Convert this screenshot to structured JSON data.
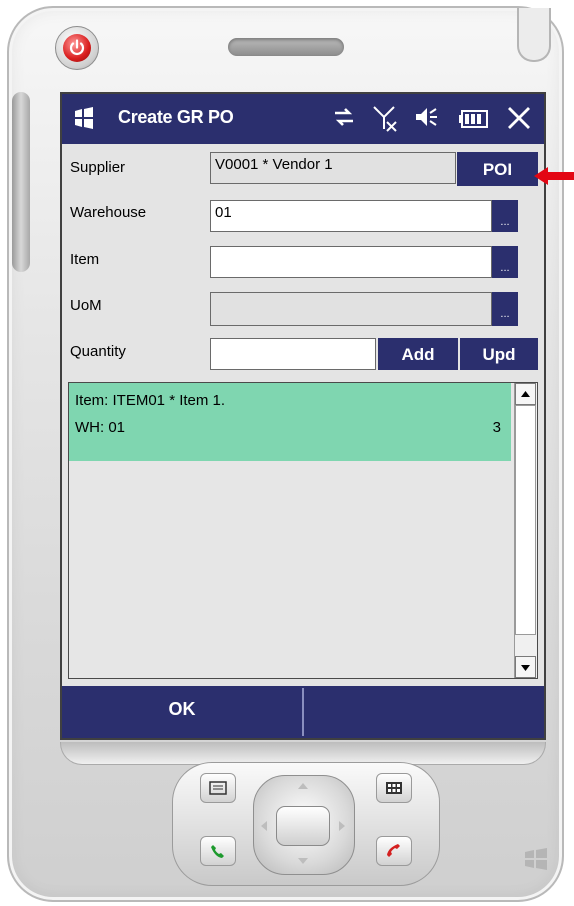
{
  "app": {
    "title": "Create GR PO"
  },
  "status_icons": [
    "sync-icon",
    "no-signal-icon",
    "volume-icon",
    "battery-icon",
    "close-icon"
  ],
  "form": {
    "supplier": {
      "label": "Supplier",
      "value": "V0001 * Vendor 1",
      "button": "POI"
    },
    "warehouse": {
      "label": "Warehouse",
      "value": "01",
      "button": "..."
    },
    "item": {
      "label": "Item",
      "value": "",
      "button": "..."
    },
    "uom": {
      "label": "UoM",
      "value": "",
      "button": "..."
    },
    "quantity": {
      "label": "Quantity",
      "value": "",
      "add_label": "Add",
      "upd_label": "Upd"
    }
  },
  "list": {
    "items": [
      {
        "line1": "Item: ITEM01 * Item 1.",
        "line2": "WH: 01",
        "qty": "3"
      }
    ]
  },
  "softkeys": {
    "left": "OK",
    "right": ""
  },
  "colors": {
    "navy": "#2b2f6e",
    "selected_row": "#7fd6b0",
    "annotation_arrow": "#e30613"
  }
}
